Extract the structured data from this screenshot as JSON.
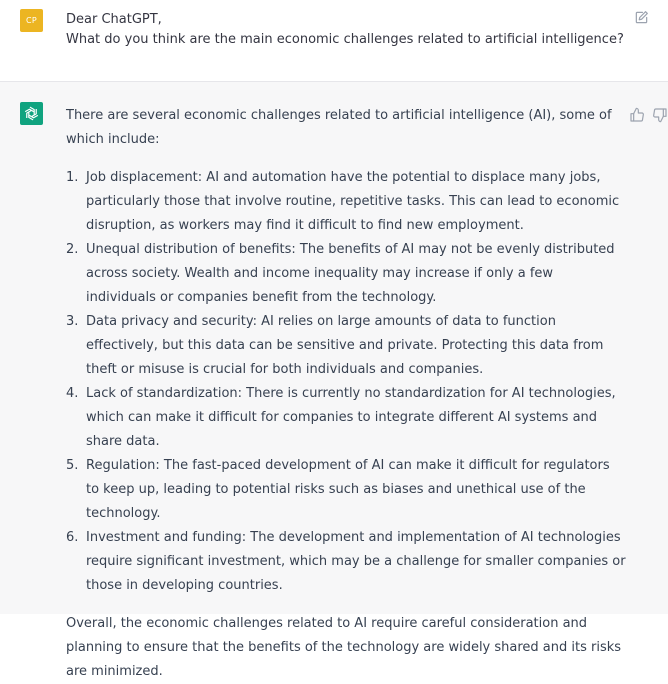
{
  "user_message": {
    "avatar_initials": "CP",
    "lines": [
      "Dear ChatGPT,",
      "What do you think are the main economic challenges related to artificial intelligence?"
    ],
    "edit_icon": "edit-icon"
  },
  "assistant_message": {
    "avatar_icon": "openai-logo-icon",
    "intro": "There are several economic challenges related to artificial intelligence (AI), some of which include:",
    "points": [
      {
        "num": "1.",
        "text": "Job displacement: AI and automation have the potential to displace many jobs, particularly those that involve routine, repetitive tasks. This can lead to economic disruption, as workers may find it difficult to find new employment."
      },
      {
        "num": "2.",
        "text": "Unequal distribution of benefits: The benefits of AI may not be evenly distributed across society. Wealth and income inequality may increase if only a few individuals or companies benefit from the technology."
      },
      {
        "num": "3.",
        "text": "Data privacy and security: AI relies on large amounts of data to function effectively, but this data can be sensitive and private. Protecting this data from theft or misuse is crucial for both individuals and companies."
      },
      {
        "num": "4.",
        "text": "Lack of standardization: There is currently no standardization for AI technologies, which can make it difficult for companies to integrate different AI systems and share data."
      },
      {
        "num": "5.",
        "text": "Regulation: The fast-paced development of AI can make it difficult for regulators to keep up, leading to potential risks such as biases and unethical use of the technology."
      },
      {
        "num": "6.",
        "text": "Investment and funding: The development and implementation of AI technologies require significant investment, which may be a challenge for smaller companies or those in developing countries."
      }
    ],
    "outro": "Overall, the economic challenges related to AI require careful consideration and planning to ensure that the benefits of the technology are widely shared and its risks are minimized.",
    "feedback_icons": [
      "thumbs-up-icon",
      "thumbs-down-icon"
    ]
  },
  "colors": {
    "user_avatar": "#ecb522",
    "assistant_avatar": "#10a37f",
    "assistant_bg": "#f7f7f8",
    "text": "#374151"
  }
}
